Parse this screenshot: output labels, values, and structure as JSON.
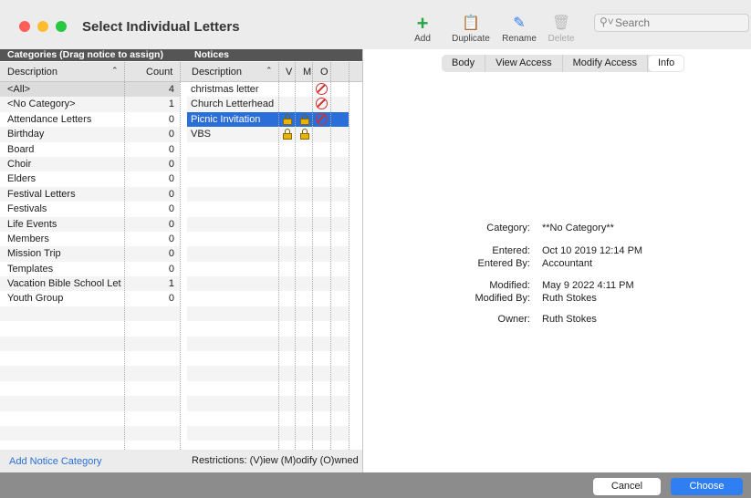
{
  "window": {
    "title": "Select Individual Letters",
    "traffic_colors": [
      "#ff5f57",
      "#febc2e",
      "#28c840"
    ]
  },
  "toolbar": {
    "add": {
      "label": "Add",
      "icon": "plus-icon"
    },
    "duplicate": {
      "label": "Duplicate",
      "icon": "duplicate-icon"
    },
    "rename": {
      "label": "Rename",
      "icon": "rename-icon"
    },
    "delete": {
      "label": "Delete",
      "icon": "trash-icon"
    },
    "search_placeholder": "Search"
  },
  "categories": {
    "header": "Categories (Drag notice to assign)",
    "col_description": "Description",
    "col_count": "Count",
    "rows": [
      {
        "label": "<All>",
        "count": "4",
        "selected": true
      },
      {
        "label": "<No Category>",
        "count": "1"
      },
      {
        "label": "Attendance Letters",
        "count": "0"
      },
      {
        "label": "Birthday",
        "count": "0"
      },
      {
        "label": "Board",
        "count": "0"
      },
      {
        "label": "Choir",
        "count": "0"
      },
      {
        "label": "Elders",
        "count": "0"
      },
      {
        "label": "Festival Letters",
        "count": "0"
      },
      {
        "label": "Festivals",
        "count": "0"
      },
      {
        "label": "Life Events",
        "count": "0"
      },
      {
        "label": "Members",
        "count": "0"
      },
      {
        "label": "Mission Trip",
        "count": "0"
      },
      {
        "label": "Templates",
        "count": "0"
      },
      {
        "label": "Vacation Bible School Let",
        "count": "1"
      },
      {
        "label": "Youth Group",
        "count": "0"
      }
    ],
    "add_label": "Add Notice Category"
  },
  "notices": {
    "header": "Notices",
    "col_description": "Description",
    "col_v": "V",
    "col_m": "M",
    "col_o": "O",
    "rows": [
      {
        "label": "christmas letter",
        "v": false,
        "m": false,
        "o": true
      },
      {
        "label": "Church Letterhead",
        "v": false,
        "m": false,
        "o": true
      },
      {
        "label": "Picnic Invitation",
        "v": true,
        "m": true,
        "o": true,
        "highlighted": true
      },
      {
        "label": "VBS",
        "v": true,
        "m": true,
        "o": false
      }
    ],
    "restrictions": "Restrictions: (V)iew (M)odify (O)wned"
  },
  "tabs": [
    {
      "label": "Body"
    },
    {
      "label": "View Access"
    },
    {
      "label": "Modify Access"
    },
    {
      "label": "Info",
      "active": true
    }
  ],
  "info": {
    "category_label": "Category:",
    "category_value": "**No Category**",
    "entered_label": "Entered:",
    "entered_value": "Oct 10 2019 12:14 PM",
    "entered_by_label": "Entered By:",
    "entered_by_value": "Accountant",
    "modified_label": "Modified:",
    "modified_value": "May 9 2022 4:11 PM",
    "modified_by_label": "Modified By:",
    "modified_by_value": "Ruth Stokes",
    "owner_label": "Owner:",
    "owner_value": "Ruth Stokes"
  },
  "buttons": {
    "cancel": "Cancel",
    "choose": "Choose"
  }
}
